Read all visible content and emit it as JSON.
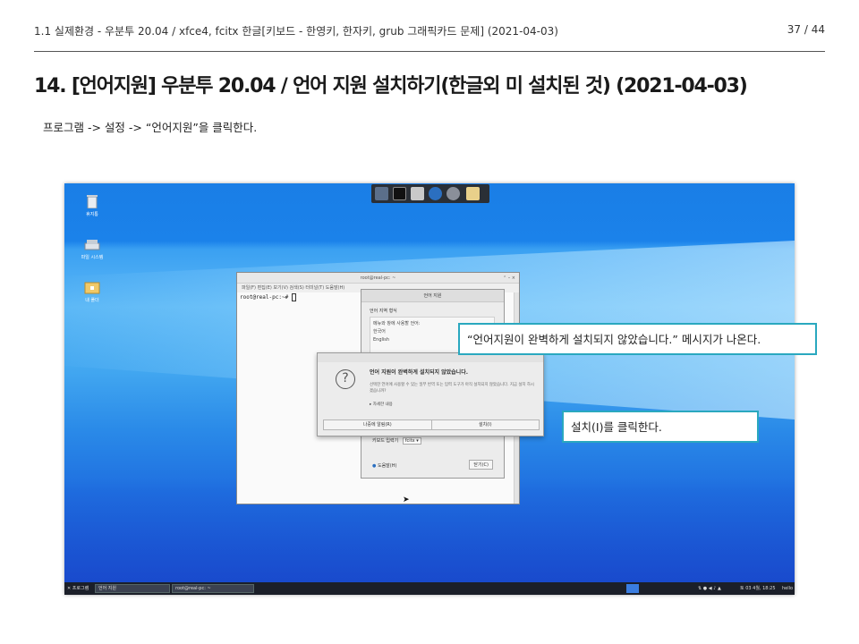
{
  "header": {
    "breadcrumb": "1.1 실제환경 - 우분투 20.04 / xfce4, fcitx 한글[키보드 - 한영키, 한자키, grub 그래픽카드 문제] (2021-04-03)",
    "page": "37 / 44"
  },
  "title": "14. [언어지원] 우분투 20.04 / 언어 지원 설치하기(한글외 미 설치된 것) (2021-04-03)",
  "instruction": "프로그램 -> 설정 -> “언어지원”을 클릭한다.",
  "screenshot": {
    "desktop_icons": [
      {
        "label": "휴지통",
        "icon": "trash-icon"
      },
      {
        "label": "파일 시스템",
        "icon": "drive-icon"
      },
      {
        "label": "내 폴더",
        "icon": "home-folder-icon"
      }
    ],
    "terminal": {
      "title": "root@real-pc: ~",
      "menu": "파일(F)   편집(E)   보기(V)   검색(S)   터미널(T)   도움말(H)",
      "prompt": "root@real-pc:~# "
    },
    "language_window": {
      "title": "언어 지원",
      "tabs": "언어      지역 형식",
      "panel_heading": "메뉴와 창에 사용할 언어:",
      "lang1": "한국어",
      "lang2": "English",
      "keyboard_label": "키보드 입력기",
      "keyboard_value": "fcitx",
      "help": "도움말(H)",
      "close": "닫기(C)"
    },
    "dialog": {
      "heading": "언어 지원이 완벽하게 설치되지 않았습니다.",
      "body": "선택한 언어에 사용할 수 있는 일부 번역 또는 입력 도구가 아직 설치되지 않았습니다. 지금 설치 하시겠습니까?",
      "details": "▸ 자세한 내용",
      "later": "나중에 알림(R)",
      "install": "설치(I)"
    },
    "taskbar": {
      "programs": "프로그램",
      "task1": "언어 지원",
      "task2": "root@real-pc: ~",
      "clock": "토 03 4월, 18:25",
      "user": "hello"
    }
  },
  "callouts": {
    "message": "“언어지원이 완벽하게 설치되지 않았습니다.” 메시지가 나온다.",
    "install": "설치(I)를 클릭한다."
  }
}
